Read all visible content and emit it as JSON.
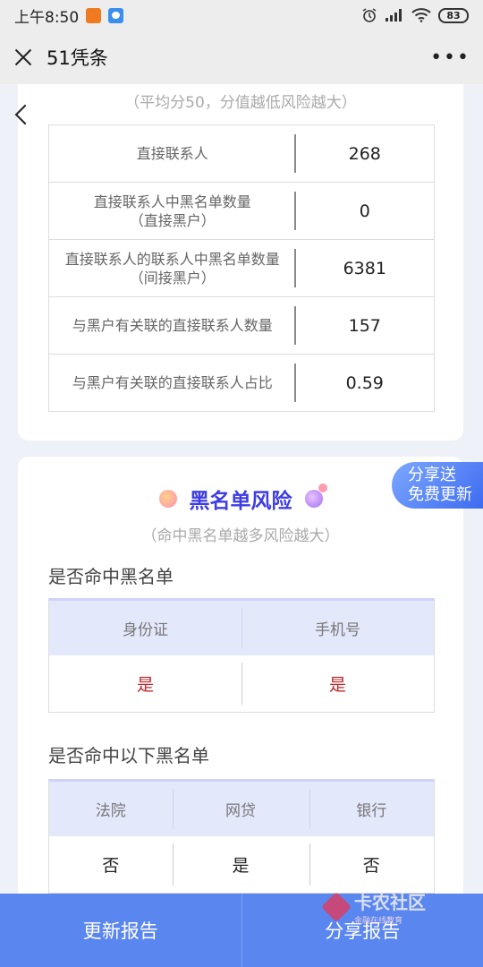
{
  "status_bar": {
    "time": "上午8:50",
    "battery": "83"
  },
  "title_bar": {
    "title": "51凭条"
  },
  "contacts": {
    "note": "（平均分50，分值越低风险越大）",
    "rows": [
      {
        "label": "直接联系人",
        "value": "268"
      },
      {
        "label": "直接联系人中黑名单数量",
        "sub": "（直接黑户）",
        "value": "0"
      },
      {
        "label": "直接联系人的联系人中黑名单数量",
        "sub": "（间接黑户）",
        "value": "6381"
      },
      {
        "label": "与黑户有关联的直接联系人数量",
        "value": "157"
      },
      {
        "label": "与黑户有关联的直接联系人占比",
        "value": "0.59"
      }
    ]
  },
  "blacklist": {
    "title": "黑名单风险",
    "note": "（命中黑名单越多风险越大）",
    "hit_title": "是否命中黑名单",
    "hit_headers": [
      "身份证",
      "手机号"
    ],
    "hit_values": [
      "是",
      "是"
    ],
    "list_title": "是否命中以下黑名单",
    "list_headers": [
      "法院",
      "网贷",
      "银行"
    ],
    "list_values": [
      "否",
      "是",
      "否"
    ]
  },
  "share_badge": {
    "line1": "分享送",
    "line2": "免费更新"
  },
  "bottom": {
    "update": "更新报告",
    "share": "分享报告"
  },
  "watermark": {
    "title": "卡农社区",
    "subtitle": "金融在线教育"
  },
  "colors": {
    "accent": "#3d3ce6",
    "bottom_bar": "#5a86ef",
    "hit": "#c0282d"
  }
}
